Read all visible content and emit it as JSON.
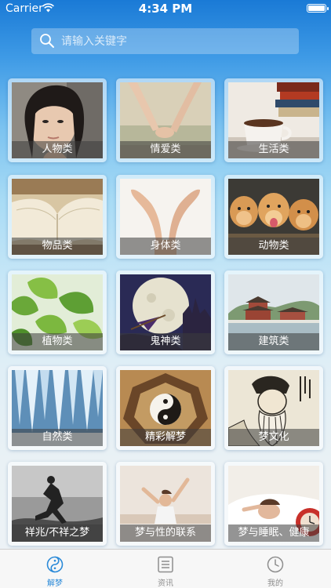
{
  "status_bar": {
    "carrier": "Carrier",
    "time": "4:34 PM"
  },
  "search": {
    "placeholder": "请输入关键字"
  },
  "categories": [
    "人物类",
    "情爱类",
    "生活类",
    "物品类",
    "身体类",
    "动物类",
    "植物类",
    "鬼神类",
    "建筑类",
    "自然类",
    "精彩解梦",
    "梦文化",
    "祥兆/不祥之梦",
    "梦与性的联系",
    "梦与睡眠、健康"
  ],
  "tabs": [
    {
      "label": "解梦",
      "icon": "yin-yang-icon",
      "active": true
    },
    {
      "label": "资讯",
      "icon": "news-icon",
      "active": false
    },
    {
      "label": "我的",
      "icon": "clock-icon",
      "active": false
    }
  ],
  "colors": {
    "accent": "#2b8ad8",
    "inactive": "#8e8e8e"
  }
}
